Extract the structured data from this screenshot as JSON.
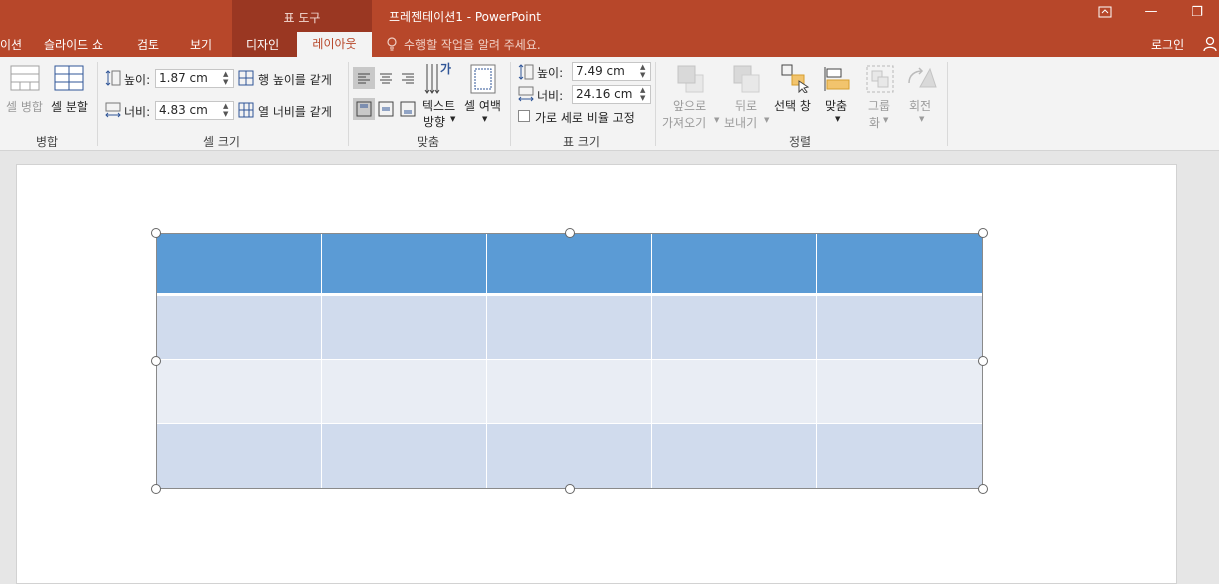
{
  "titlebar": {
    "tool_tab": "표 도구",
    "document_title": "프레젠테이션1 - PowerPoint",
    "ribbon_display_icon": "ribbon-display-icon",
    "minimize_glyph": "—",
    "restore_glyph": "❐"
  },
  "tabs": [
    {
      "label": "이션",
      "active": false
    },
    {
      "label": "슬라이드 쇼",
      "active": false
    },
    {
      "label": "검토",
      "active": false
    },
    {
      "label": "보기",
      "active": false
    },
    {
      "label": "디자인",
      "active": false
    },
    {
      "label": "레이아웃",
      "active": true
    }
  ],
  "tell_me": "수행할 작업을 알려 주세요.",
  "login": "로그인",
  "ribbon": {
    "merge_group": {
      "label": "병합",
      "merge_cells": "셀 병합",
      "split_cells": "셀 분할"
    },
    "cell_size_group": {
      "label": "셀 크기",
      "height_label": "높이:",
      "height_value": "1.87 cm",
      "width_label": "너비:",
      "width_value": "4.83 cm",
      "distribute_rows": "행 높이를 같게",
      "distribute_cols": "열 너비를 같게"
    },
    "alignment_group": {
      "label": "맞춤",
      "text_direction_line1": "텍스트",
      "text_direction_line2": "방향",
      "cell_margins": "셀 여백",
      "text_direction_glyph": "가"
    },
    "table_size_group": {
      "label": "표 크기",
      "height_label": "높이:",
      "height_value": "7.49 cm",
      "width_label": "너비:",
      "width_value": "24.16 cm",
      "lock_aspect": "가로 세로 비율 고정"
    },
    "arrange_group": {
      "label": "정렬",
      "bring_forward_line1": "앞으로",
      "bring_forward_line2": "가져오기",
      "send_backward_line1": "뒤로",
      "send_backward_line2": "보내기",
      "selection_pane": "선택 창",
      "align": "맞춤",
      "group_line1": "그룹",
      "group_line2": "화",
      "rotate": "회전"
    }
  },
  "table": {
    "columns": 5,
    "rows": 4,
    "header_color": "#5b9bd5",
    "band_dark": "#d0dbed",
    "band_light": "#e9edf4"
  },
  "colors": {
    "accent": "#b7472a",
    "accent_dark": "#9a3722"
  }
}
